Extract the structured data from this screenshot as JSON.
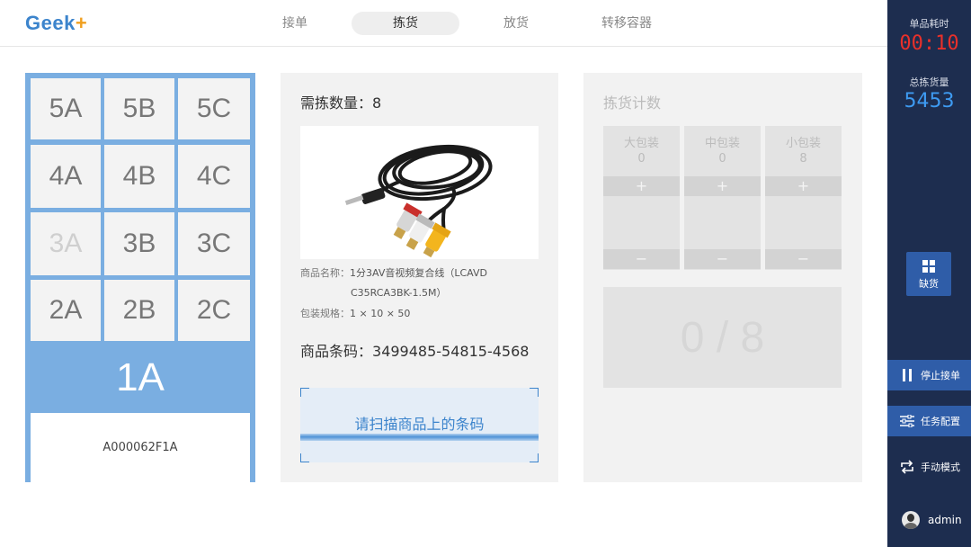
{
  "app": {
    "logo_text": "Geek",
    "logo_plus": "+"
  },
  "tabs": [
    {
      "label": "接单",
      "active": false
    },
    {
      "label": "拣货",
      "active": true
    },
    {
      "label": "放货",
      "active": false
    },
    {
      "label": "转移容器",
      "active": false
    }
  ],
  "shelf": {
    "rows": [
      [
        "5A",
        "5B",
        "5C"
      ],
      [
        "4A",
        "4B",
        "4C"
      ],
      [
        "3A",
        "3B",
        "3C"
      ],
      [
        "2A",
        "2B",
        "2C"
      ]
    ],
    "disabled_bin": "3A",
    "active_bin": "1A",
    "container_id": "A000062F1A"
  },
  "product": {
    "qty_label": "需拣数量：",
    "qty_value": "8",
    "name_label": "商品名称：",
    "name_line1": "1分3AV音视频复合线（LCAVD",
    "name_line2": "C35RCA3BK-1.5M）",
    "spec_label": "包装规格：",
    "spec_value": "1 × 10 × 50",
    "barcode_label": "商品条码：",
    "barcode_value": "3499485-54815-4568",
    "scan_prompt": "请扫描商品上的条码"
  },
  "counter": {
    "title": "拣货计数",
    "packs": [
      {
        "name": "大包装",
        "count": "0"
      },
      {
        "name": "中包装",
        "count": "0"
      },
      {
        "name": "小包装",
        "count": "8"
      }
    ],
    "plus_symbol": "+",
    "minus_symbol": "−",
    "progress_text": "0 / 8",
    "picked": 0,
    "required": 8
  },
  "sidebar": {
    "time_label": "单品耗时",
    "time_value": "00:10",
    "total_label": "总拣货量",
    "total_value": "5453",
    "shortage_label": "缺货",
    "stop_label": "停止接单",
    "config_label": "任务配置",
    "manual_label": "手动模式",
    "username": "admin"
  },
  "colors": {
    "brand_blue": "#3c84cc",
    "sidebar_bg": "#1d2d4f",
    "accent_button": "#2f5da8",
    "timer_red": "#e9302a",
    "total_blue": "#3e9bf2",
    "shelf_blue": "#7aaee1"
  }
}
